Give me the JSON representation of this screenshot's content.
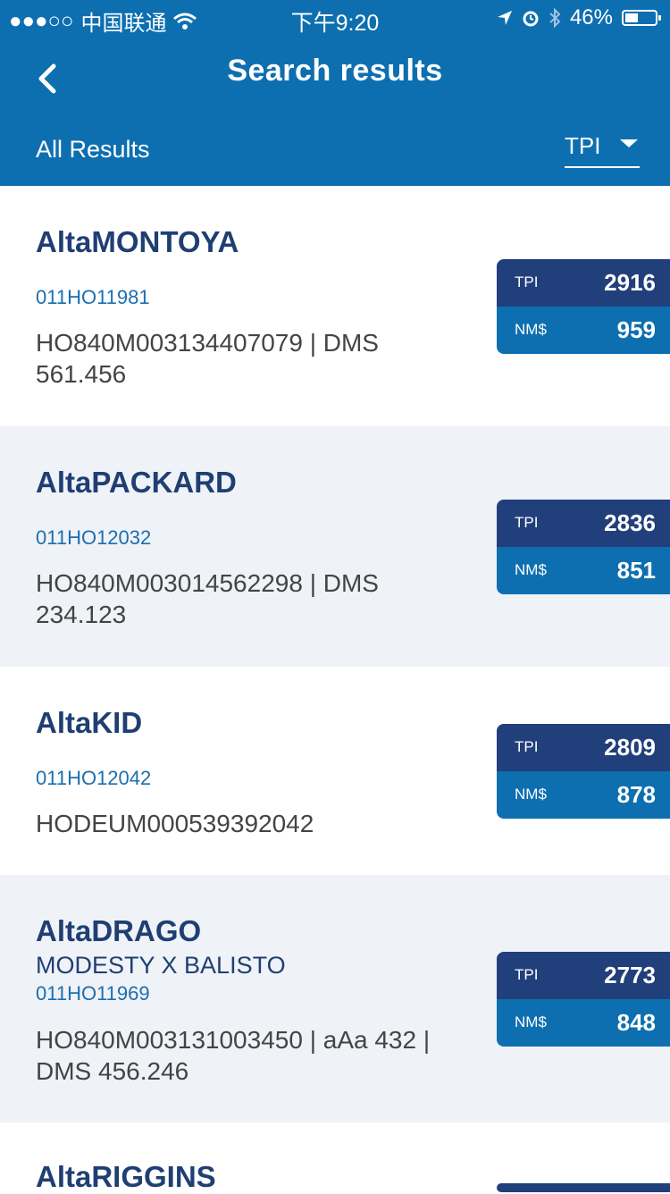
{
  "status": {
    "carrier": "中国联通",
    "signal": "●●●○○",
    "time": "下午9:20",
    "battery": "46%",
    "battery_level": 0.46
  },
  "header": {
    "title": "Search results",
    "subtitle": "All Results",
    "sort_label": "TPI"
  },
  "results": [
    {
      "name": "AltaMONTOYA",
      "pedigree": "",
      "code": "011HO11981",
      "detail": "HO840M003134407079 | DMS 561.456",
      "tpi_label": "TPI",
      "tpi": "2916",
      "nm_label": "NM$",
      "nm": "959"
    },
    {
      "name": "AltaPACKARD",
      "pedigree": "",
      "code": "011HO12032",
      "detail": "HO840M003014562298 | DMS 234.123",
      "tpi_label": "TPI",
      "tpi": "2836",
      "nm_label": "NM$",
      "nm": "851"
    },
    {
      "name": "AltaKID",
      "pedigree": "",
      "code": "011HO12042",
      "detail": "HODEUM000539392042",
      "tpi_label": "TPI",
      "tpi": "2809",
      "nm_label": "NM$",
      "nm": "878"
    },
    {
      "name": "AltaDRAGO",
      "pedigree": "MODESTY X BALISTO",
      "code": "011HO11969",
      "detail": "HO840M003131003450 | aAa 432 | DMS 456.246",
      "tpi_label": "TPI",
      "tpi": "2773",
      "nm_label": "NM$",
      "nm": "848"
    },
    {
      "name": "AltaRIGGINS",
      "pedigree": "",
      "code": "",
      "detail": "",
      "tpi_label": "",
      "tpi": "",
      "nm_label": "",
      "nm": ""
    }
  ]
}
